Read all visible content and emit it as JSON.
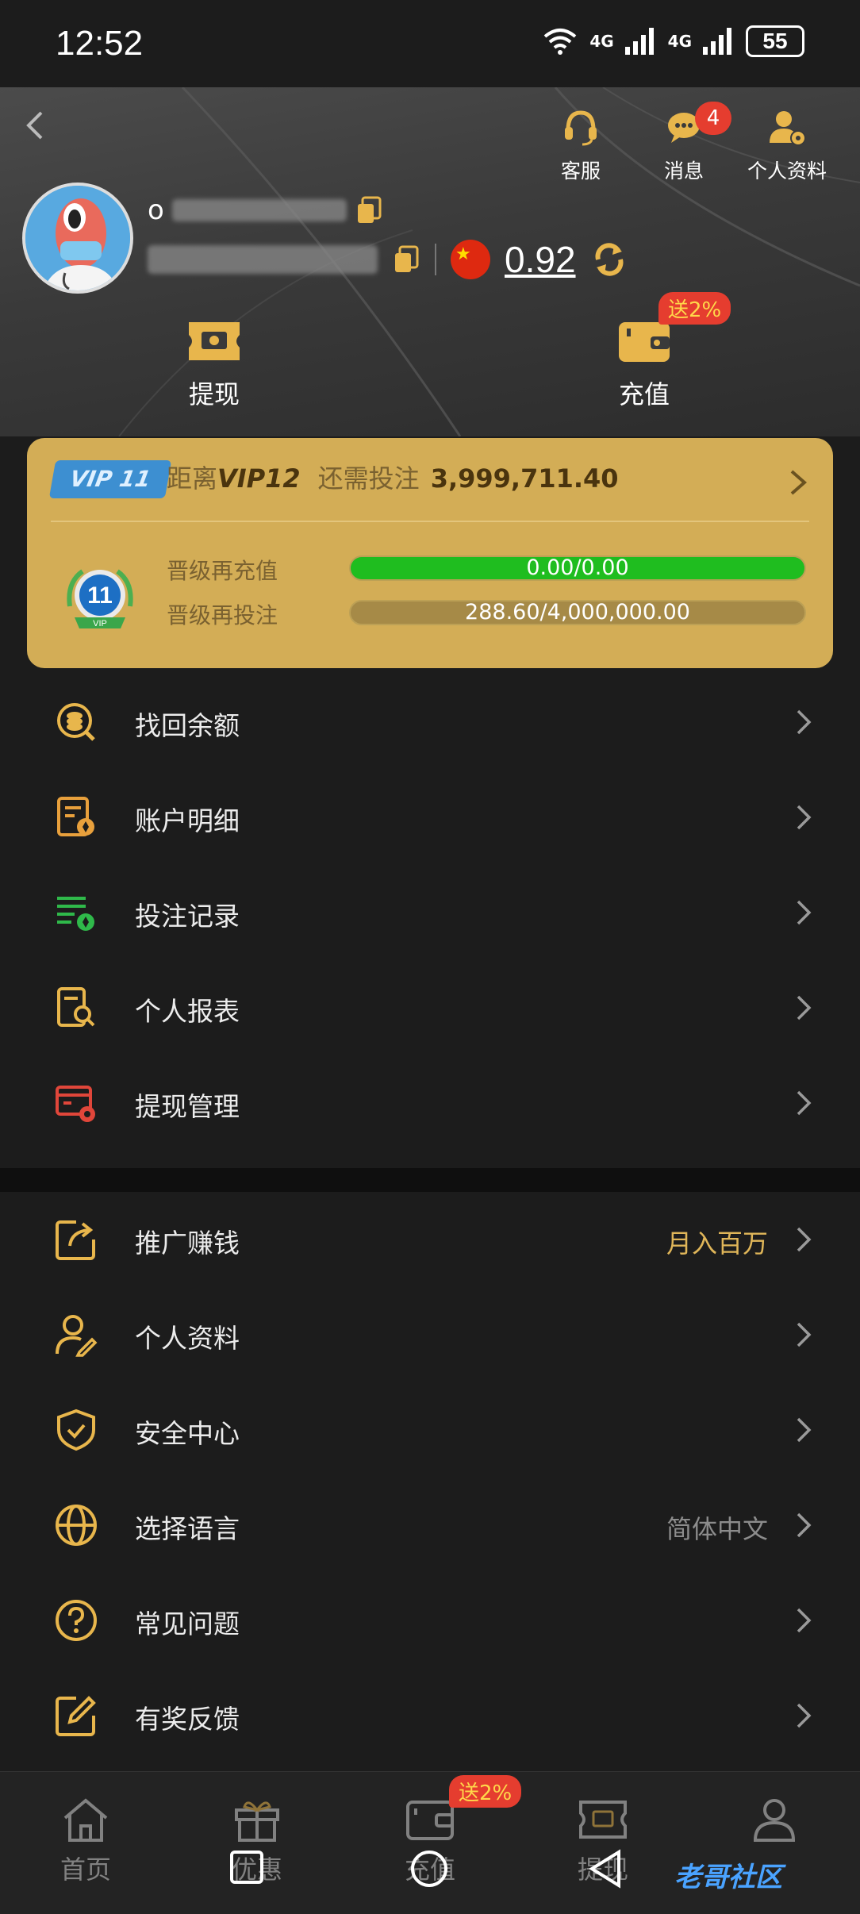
{
  "status_bar": {
    "time": "12:52",
    "battery": "55",
    "net1": "4G",
    "net2": "4G"
  },
  "header": {
    "actions": {
      "support": "客服",
      "messages": "消息",
      "profile": "个人资料"
    },
    "message_count": "4",
    "balance": "0.92",
    "user_initial": "o",
    "withdraw_label": "提现",
    "deposit_label": "充值",
    "deposit_bonus": "送2%"
  },
  "vip": {
    "current_tag": "VIP 11",
    "distance_text": "距离",
    "next_level": "VIP12",
    "need_text": "还需投注",
    "need_amount": "3,999,711.40",
    "medal_level": "11",
    "medal_caption": "VIP",
    "recharge_label": "晋级再充值",
    "recharge_progress": "0.00/0.00",
    "recharge_fraction": 1.0,
    "bet_label": "晋级再投注",
    "bet_progress": "288.60/4,000,000.00",
    "bet_fraction": 0.0001
  },
  "menu_primary": [
    {
      "label": "找回余额",
      "icon": "coins-search-icon"
    },
    {
      "label": "账户明细",
      "icon": "account-details-icon"
    },
    {
      "label": "投注记录",
      "icon": "bet-record-icon"
    },
    {
      "label": "个人报表",
      "icon": "report-search-icon"
    },
    {
      "label": "提现管理",
      "icon": "withdraw-settings-icon"
    }
  ],
  "menu_secondary": [
    {
      "label": "推广赚钱",
      "extra": "月入百万",
      "icon": "share-icon"
    },
    {
      "label": "个人资料",
      "extra": "",
      "icon": "user-edit-icon"
    },
    {
      "label": "安全中心",
      "extra": "",
      "icon": "shield-icon"
    },
    {
      "label": "选择语言",
      "extra": "简体中文",
      "icon": "globe-icon"
    },
    {
      "label": "常见问题",
      "extra": "",
      "icon": "question-icon"
    },
    {
      "label": "有奖反馈",
      "extra": "",
      "icon": "feedback-edit-icon"
    }
  ],
  "colors": {
    "gold": "#d3ad56",
    "icon_gold": "#e8b64c",
    "accent_green": "#1fbd1f",
    "badge_red": "#e53d2f",
    "extra_gold": "#e0b659",
    "extra_gray": "#8c8c8c"
  },
  "bottom_nav": {
    "home": "首页",
    "promo": "优惠",
    "deposit": "充值",
    "withdraw": "提现",
    "deposit_bonus": "送2%"
  },
  "watermark": "老哥社区"
}
